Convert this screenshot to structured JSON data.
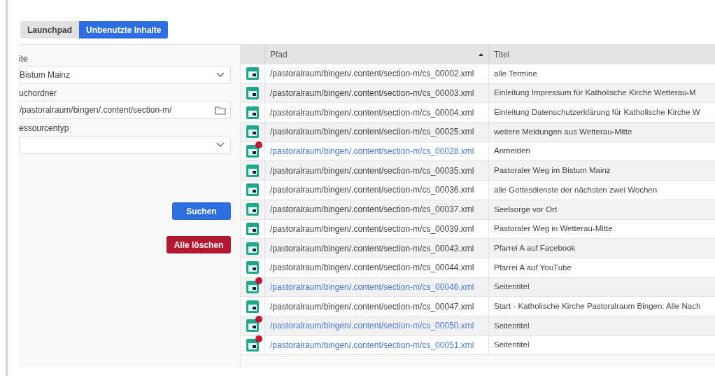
{
  "breadcrumb": [
    {
      "label": "Launchpad",
      "selected": false
    },
    {
      "label": "Unbenutzte Inhalte",
      "selected": true
    }
  ],
  "form": {
    "site_label": "ite",
    "site_value": "Bistum Mainz",
    "folder_label": "uchordner",
    "folder_value": "/pastoralraum/bingen/.content/section-m/",
    "type_label": "essourcentyp",
    "search_button": "Suchen",
    "delete_button": "Alle löschen"
  },
  "table": {
    "columns": [
      {
        "sorted": false
      },
      {
        "label": "Pfad",
        "sorted": true
      },
      {
        "label": "Titel",
        "sorted": false
      }
    ],
    "rows": [
      {
        "path": "/pastoralraum/bingen/.content/section-m/cs_00002.xml",
        "title": "alle Termine",
        "changed": false
      },
      {
        "path": "/pastoralraum/bingen/.content/section-m/cs_00003.xml",
        "title": "Einleitung Impressum für Katholische Kirche Wetterau-M",
        "changed": false
      },
      {
        "path": "/pastoralraum/bingen/.content/section-m/cs_00004.xml",
        "title": "Einleitung Datenschutzerklärung für Katholische Kirche W",
        "changed": false
      },
      {
        "path": "/pastoralraum/bingen/.content/section-m/cs_00025.xml",
        "title": "weitere Meldungen aus Wetterau-Mitte",
        "changed": false
      },
      {
        "path": "/pastoralraum/bingen/.content/section-m/cs_00028.xml",
        "title": "Anmelden",
        "changed": true
      },
      {
        "path": "/pastoralraum/bingen/.content/section-m/cs_00035.xml",
        "title": "Pastoraler Weg im Bistum Mainz",
        "changed": false
      },
      {
        "path": "/pastoralraum/bingen/.content/section-m/cs_00036.xml",
        "title": "alle Gottesdienste der nächsten zwei Wochen",
        "changed": false
      },
      {
        "path": "/pastoralraum/bingen/.content/section-m/cs_00037.xml",
        "title": "Seelsorge vor Ort",
        "changed": false
      },
      {
        "path": "/pastoralraum/bingen/.content/section-m/cs_00039.xml",
        "title": "Pastoraler Weg in Wetterau-Mitte",
        "changed": false
      },
      {
        "path": "/pastoralraum/bingen/.content/section-m/cs_00043.xml",
        "title": "Pfarrei A auf Facebook",
        "changed": false
      },
      {
        "path": "/pastoralraum/bingen/.content/section-m/cs_00044.xml",
        "title": "Pfarrei A auf YouTube",
        "changed": false
      },
      {
        "path": "/pastoralraum/bingen/.content/section-m/cs_00046.xml",
        "title": "Seitentitel",
        "changed": true
      },
      {
        "path": "/pastoralraum/bingen/.content/section-m/cs_00047.xml",
        "title": "Start - Katholische Kirche Pastoralraum Bingen: Alle Nach",
        "changed": false
      },
      {
        "path": "/pastoralraum/bingen/.content/section-m/cs_00050.xml",
        "title": "Seitentitel",
        "changed": true
      },
      {
        "path": "/pastoralraum/bingen/.content/section-m/cs_00051.xml",
        "title": "Seitentitel",
        "changed": true
      }
    ]
  }
}
